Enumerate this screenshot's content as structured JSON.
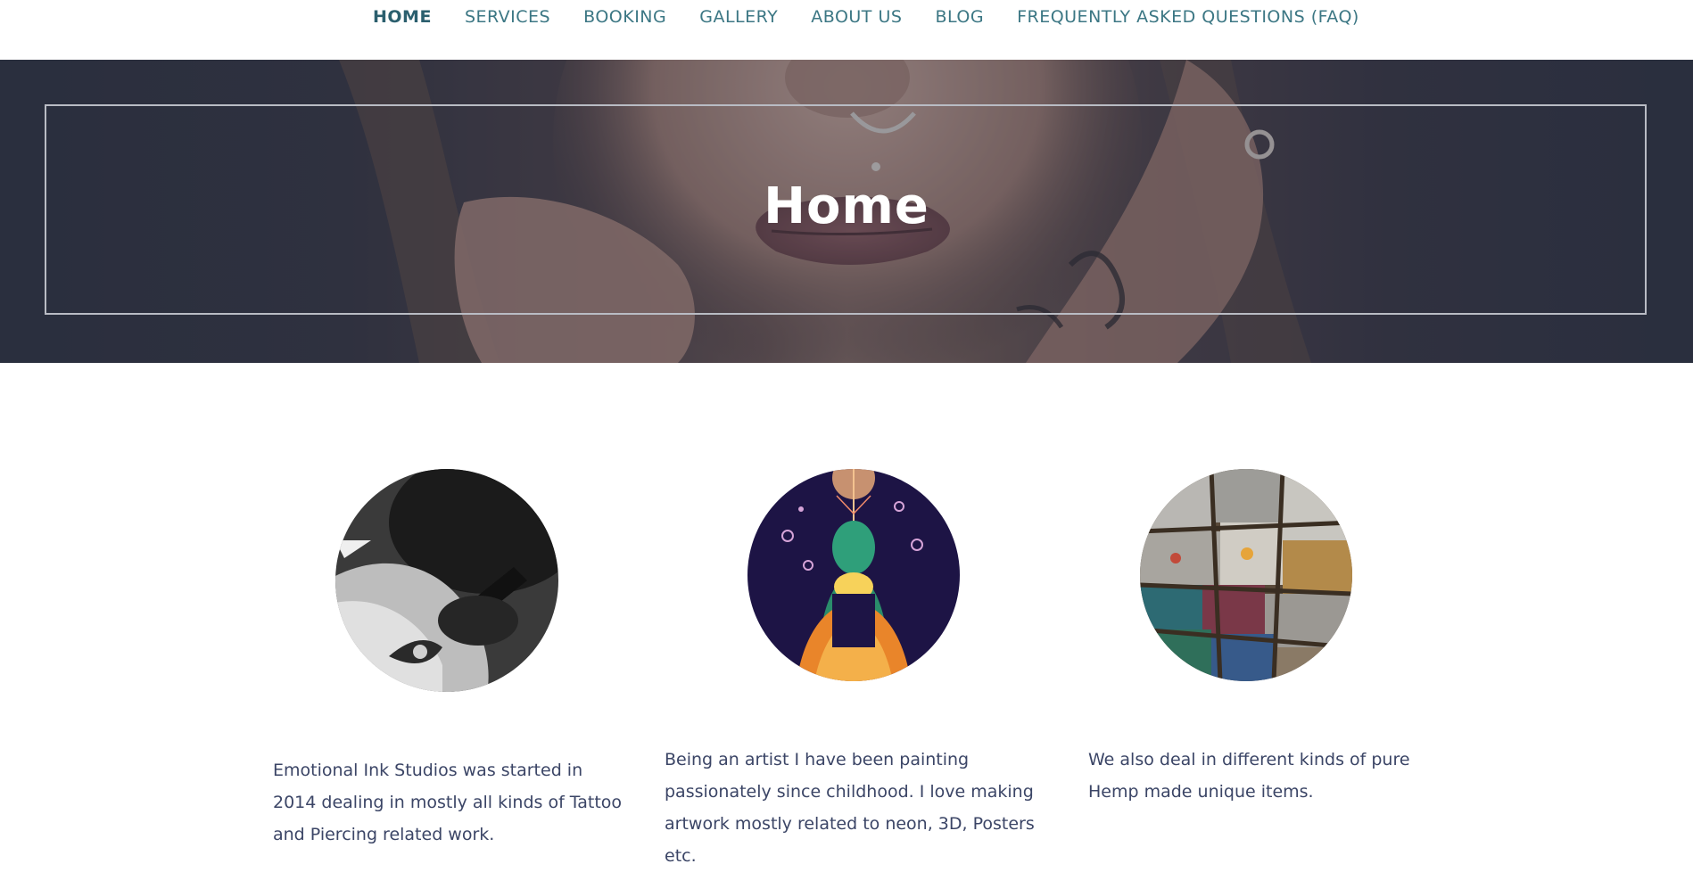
{
  "nav": {
    "items": [
      {
        "label": "HOME",
        "active": true
      },
      {
        "label": "SERVICES",
        "active": false
      },
      {
        "label": "BOOKING",
        "active": false
      },
      {
        "label": "GALLERY",
        "active": false
      },
      {
        "label": "ABOUT US",
        "active": false
      },
      {
        "label": "BLOG",
        "active": false
      },
      {
        "label": "FREQUENTLY ASKED QUESTIONS (FAQ)",
        "active": false
      }
    ]
  },
  "hero": {
    "title": "Home"
  },
  "features": [
    {
      "image_icon": "tattoo-photo",
      "text": "Emotional Ink Studios was started in 2014 dealing in mostly all kinds of Tattoo and Piercing related work."
    },
    {
      "image_icon": "buddha-artwork",
      "text": "Being an artist I have been painting passionately since childhood. I love making artwork mostly related to neon, 3D, Posters etc."
    },
    {
      "image_icon": "hemp-items-photo",
      "text": "We also deal in different kinds of pure Hemp made unique items."
    }
  ],
  "colors": {
    "nav_text": "#3c7784",
    "body_text": "#3b4566",
    "hero_title": "#ffffff"
  }
}
